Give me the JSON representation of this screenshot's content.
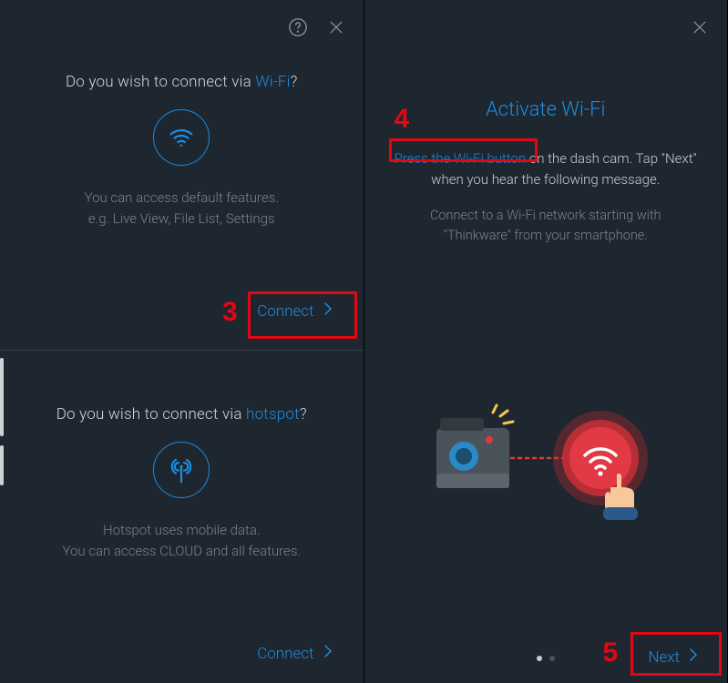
{
  "left": {
    "wifi": {
      "prompt_pre": "Do you wish to connect via ",
      "prompt_accent": "Wi-Fi",
      "prompt_post": "?",
      "desc_line1": "You can access default features.",
      "desc_line2": "e.g. Live View, File List, Settings",
      "connect_label": "Connect"
    },
    "hotspot": {
      "prompt_pre": "Do you wish to connect via ",
      "prompt_accent": "hotspot",
      "prompt_post": "?",
      "desc_line1": "Hotspot uses mobile data.",
      "desc_line2": "You can access CLOUD and all features.",
      "connect_label": "Connect"
    }
  },
  "right": {
    "title": "Activate Wi-Fi",
    "instr_accent": "Press the Wi-Fi button",
    "instr_rest": " on the dash cam. Tap \"Next\" when you hear the following message.",
    "sub": "Connect to a Wi-Fi network starting with \"Thinkware\" from your smartphone.",
    "next_label": "Next"
  },
  "steps": {
    "s3": "3",
    "s4": "4",
    "s5": "5"
  }
}
